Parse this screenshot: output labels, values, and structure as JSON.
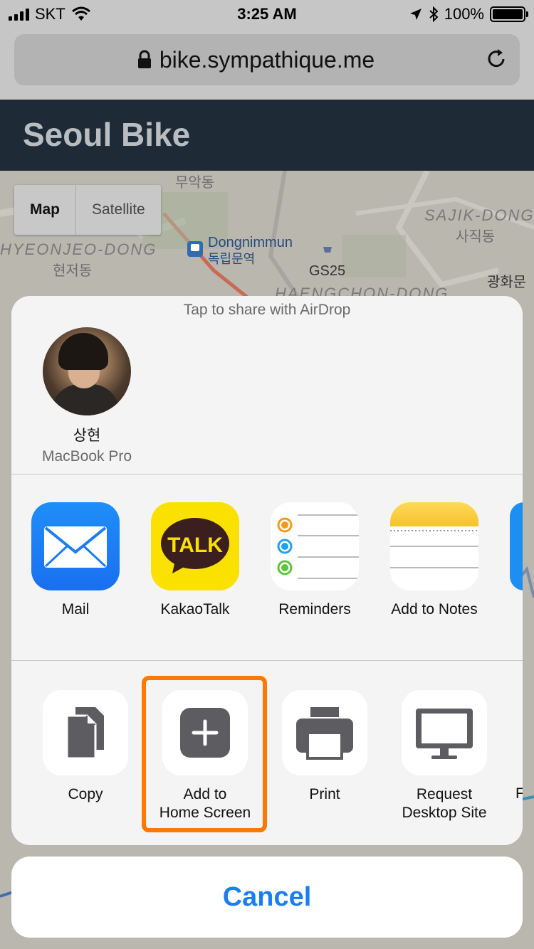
{
  "status_bar": {
    "carrier": "SKT",
    "time": "3:25 AM",
    "battery_percent": "100%"
  },
  "url_bar": {
    "url": "bike.sympathique.me"
  },
  "app": {
    "title": "Seoul Bike"
  },
  "map": {
    "type_buttons": [
      "Map",
      "Satellite"
    ],
    "labels": [
      "무악동",
      "SAJIK-DONG",
      "사직동",
      "HYEONJEO-DONG",
      "현저동",
      "Dongnimmun",
      "독립문역",
      "GS25",
      "HAENGCHON-DONG",
      "광화문"
    ]
  },
  "share_sheet": {
    "airdrop_hint": "Tap to share with AirDrop",
    "airdrop_contact": {
      "name": "상현",
      "device": "MacBook Pro"
    },
    "apps": [
      {
        "label": "Mail",
        "icon": "mail-icon"
      },
      {
        "label": "KakaoTalk",
        "icon": "kakaotalk-icon",
        "icon_text": "TALK"
      },
      {
        "label": "Reminders",
        "icon": "reminders-icon"
      },
      {
        "label": "Add to Notes",
        "icon": "notes-icon"
      }
    ],
    "actions": [
      {
        "label": "Copy",
        "icon": "copy-icon"
      },
      {
        "label": "Add to\nHome Screen",
        "icon": "add-to-home-screen-icon",
        "highlighted": true
      },
      {
        "label": "Print",
        "icon": "print-icon"
      },
      {
        "label": "Request\nDesktop Site",
        "icon": "desktop-icon"
      },
      {
        "label": "F",
        "icon": "partial-action"
      }
    ],
    "highlight_color": "#ff7800"
  },
  "cancel_label": "Cancel",
  "colors": {
    "accent_blue": "#1a7ef2",
    "header_bg": "#1e2a36"
  }
}
